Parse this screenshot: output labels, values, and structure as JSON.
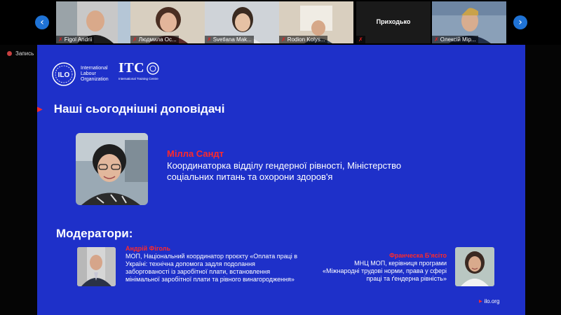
{
  "participants": [
    {
      "name": "Figol Andrii",
      "video_bg": "#c8c8c8",
      "skin": "#d9a98a",
      "shirt": "#1b1b1b"
    },
    {
      "name": "Людмила Ос...",
      "video_bg": "#d8cfc0",
      "skin": "#e3b59a",
      "shirt": "#5a2b2b"
    },
    {
      "name": "Svetlana Mak...",
      "video_bg": "#cfd3d8",
      "skin": "#e6c1a4",
      "shirt": "#e9e9e9"
    },
    {
      "name": "Rodion Kolys...",
      "video_bg": "#d9cfbf",
      "skin": "#d6a889",
      "shirt": "#3a4a5a"
    },
    {
      "name": "Приходько",
      "no_video": true
    },
    {
      "name": "Олексій Мір...",
      "video_bg": "#8aa0b8",
      "skin": "#d8ad8f",
      "shirt": "#22304a"
    }
  ],
  "nav": {
    "prev": "‹",
    "next": "›"
  },
  "recording": {
    "label": "Запись"
  },
  "slide": {
    "ilo_lines": [
      "International",
      "Labour",
      "Organization"
    ],
    "ilo_mark": "ILO",
    "itc_word": "ITC",
    "itc_sub": "International Training Centre",
    "title": "Наші сьогоднішні доповідачі",
    "speaker": {
      "name": "Мілла Сандт",
      "role": "Координаторка відділу гендерної рівності, Міністерство соціальних питань та охорони здоров'я"
    },
    "moderators_heading": "Модератори:",
    "moderator1": {
      "name": "Андрій Фіголь",
      "role": "МОП, Національний координатор проєкту «Оплата праці в Україні: технічна допомога задля подолання заборгованості із заробітної плати, встановлення мінімальної заробітної плати та рівного винагородження»"
    },
    "moderator2": {
      "name": "Франческа Б'ясіто",
      "role": "МНЦ МОП, керівниця програми «Міжнародні трудові норми, права у сфері праці та ґендерна рівність»"
    },
    "site": "ilo.org"
  },
  "colors": {
    "slide_bg": "#1e30c9",
    "accent_red": "#ff2a2a",
    "nav_blue": "#1f73d6"
  }
}
